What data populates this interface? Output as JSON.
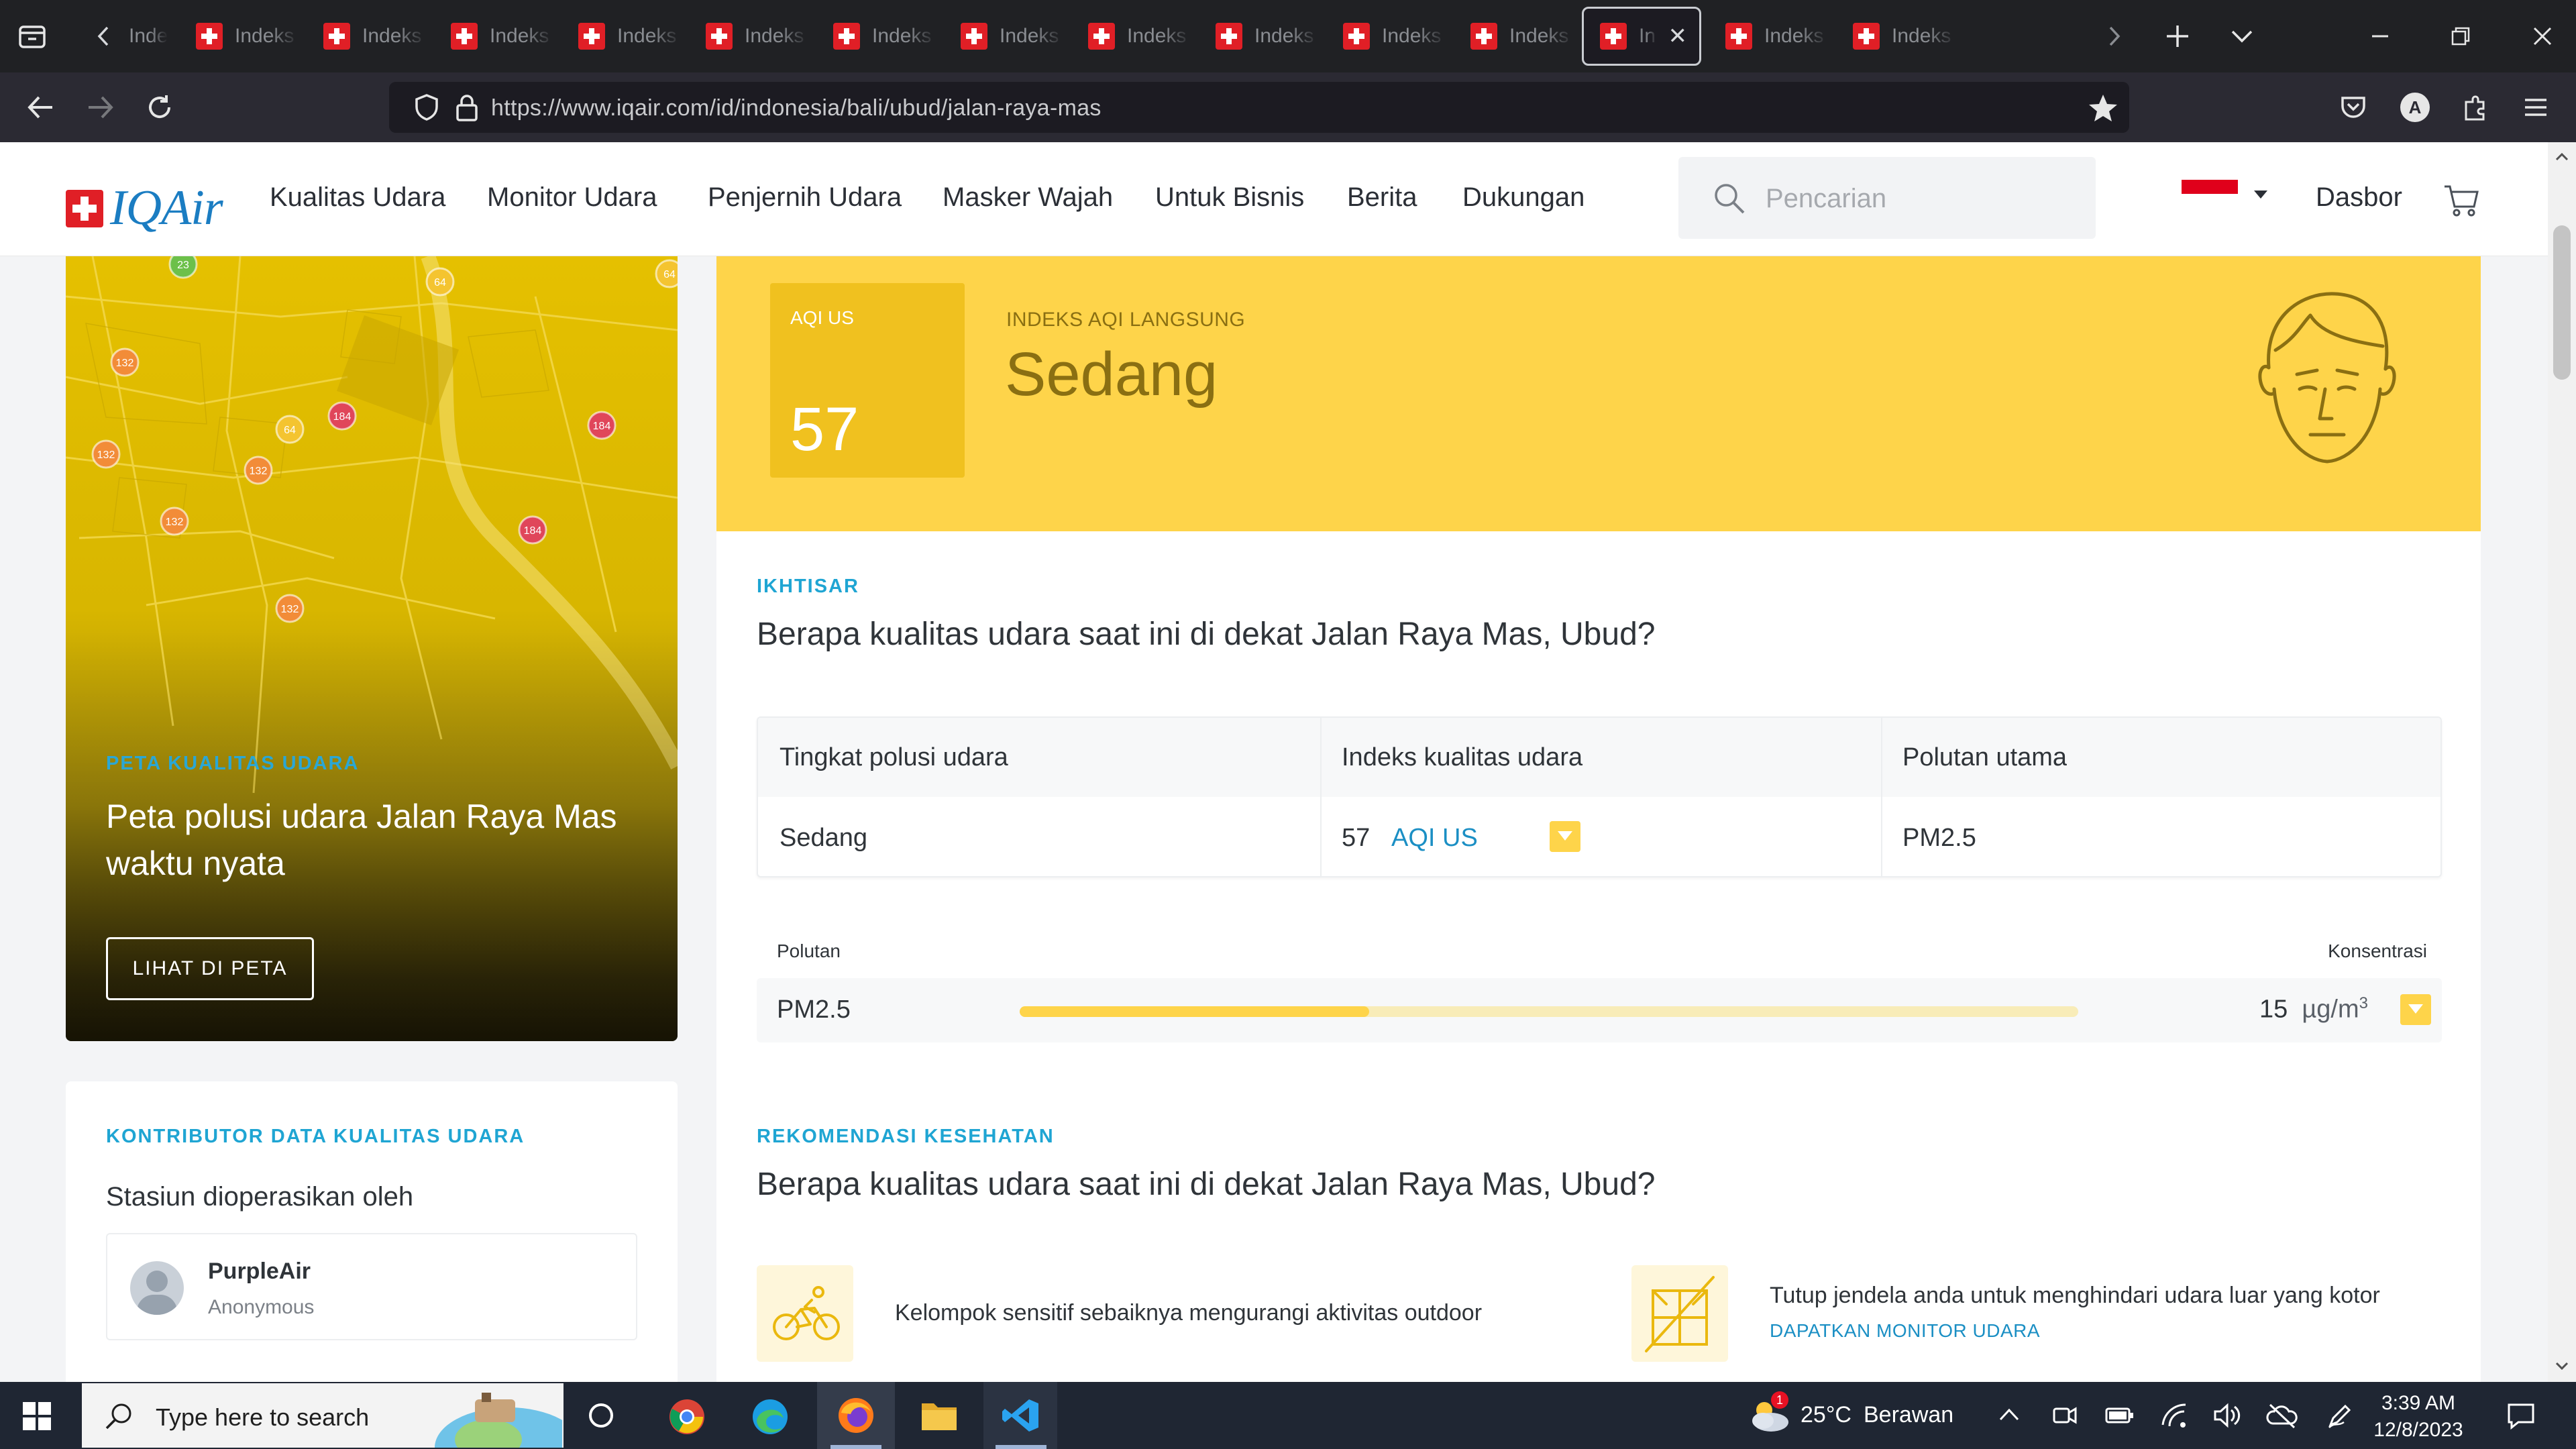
{
  "browser": {
    "tabs": [
      {
        "title": "Indeks Kualitas Udara",
        "active": false
      },
      {
        "title": "Indeks Kualitas Udara",
        "active": false
      },
      {
        "title": "Indeks Kualitas Udara",
        "active": false
      },
      {
        "title": "Indeks Kualitas Udara",
        "active": false
      },
      {
        "title": "Indeks Kualitas Udara",
        "active": false
      },
      {
        "title": "Indeks Kualitas Udara",
        "active": false
      },
      {
        "title": "Indeks Kualitas Udara",
        "active": false
      },
      {
        "title": "Indeks Kualitas Udara",
        "active": false
      },
      {
        "title": "Indeks Kualitas Udara",
        "active": false
      },
      {
        "title": "Indeks Kualitas Udara",
        "active": false
      },
      {
        "title": "Indeks Kualitas Udara",
        "active": false
      },
      {
        "title": "Indeks Kualitas Udara",
        "active": true
      },
      {
        "title": "Indeks Kualitas Udara",
        "active": false
      },
      {
        "title": "Indeks Kualitas Udara",
        "active": false
      }
    ],
    "first_tab_partial": "Indeks",
    "url": "https://www.iqair.com/id/indonesia/bali/ubud/jalan-raya-mas",
    "profile_initial": "A"
  },
  "site": {
    "logo_text": "IQAir",
    "nav": [
      "Kualitas Udara",
      "Monitor Udara",
      "Penjernih Udara",
      "Masker Wajah",
      "Untuk Bisnis",
      "Berita",
      "Dukungan"
    ],
    "search_placeholder": "Pencarian",
    "dashboard_label": "Dasbor"
  },
  "map_card": {
    "eyebrow": "PETA KUALITAS UDARA",
    "title": "Peta polusi udara Jalan Raya Mas waktu nyata",
    "button": "LIHAT DI PETA",
    "markers": [
      "23",
      "64",
      "64",
      "132",
      "184",
      "132",
      "64",
      "132",
      "184",
      "132",
      "184",
      "132"
    ]
  },
  "contributors": {
    "eyebrow": "KONTRIBUTOR DATA KUALITAS UDARA",
    "subtitle": "Stasiun dioperasikan oleh",
    "name": "PurpleAir",
    "role": "Anonymous"
  },
  "aqi_header": {
    "box_label": "AQI US",
    "value": "57",
    "live_label": "INDEKS AQI LANGSUNG",
    "status": "Sedang",
    "theme_color": "#fed44a"
  },
  "overview": {
    "eyebrow": "IKHTISAR",
    "question": "Berapa kualitas udara saat ini di dekat Jalan Raya Mas, Ubud?",
    "headers": [
      "Tingkat polusi udara",
      "Indeks kualitas udara",
      "Polutan utama"
    ],
    "level": "Sedang",
    "aqi_value": "57",
    "aqi_unit": "AQI US",
    "main_pollutant": "PM2.5"
  },
  "pollutants": {
    "col_pollutant": "Polutan",
    "col_concentration": "Konsentrasi",
    "rows": [
      {
        "name": "PM2.5",
        "value": "15",
        "unit": "µg/m",
        "unit_sup": "3",
        "fill_fraction": 0.33
      }
    ]
  },
  "health": {
    "eyebrow": "REKOMENDASI KESEHATAN",
    "question": "Berapa kualitas udara saat ini di dekat Jalan Raya Mas, Ubud?",
    "items": [
      {
        "icon": "cycling-icon",
        "text": "Kelompok sensitif sebaiknya mengurangi aktivitas outdoor"
      },
      {
        "icon": "closed-window-icon",
        "text": "Tutup jendela anda untuk menghindari udara luar yang kotor",
        "link": "DAPATKAN MONITOR UDARA"
      }
    ]
  },
  "taskbar": {
    "search_placeholder": "Type here to search",
    "weather_temp": "25°C",
    "weather_text": "Berawan",
    "weather_badge": "1",
    "time": "3:39 AM",
    "date": "12/8/2023"
  }
}
